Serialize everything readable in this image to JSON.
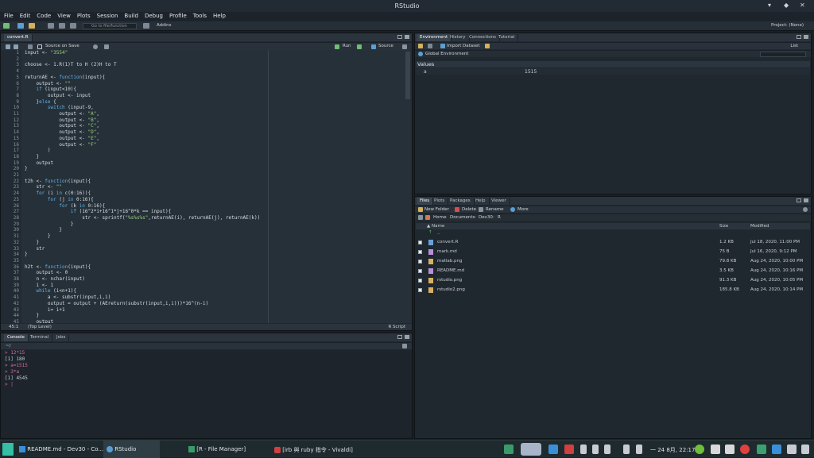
{
  "window": {
    "title": "RStudio"
  },
  "menu": [
    "File",
    "Edit",
    "Code",
    "View",
    "Plots",
    "Session",
    "Build",
    "Debug",
    "Profile",
    "Tools",
    "Help"
  ],
  "toolbar": {
    "goto_placeholder": "Go to file/function",
    "addins": "Addins",
    "project": "Project: (None)"
  },
  "editor": {
    "tab": "convert.R",
    "source_on_save": "Source on Save",
    "run": "Run",
    "source": "Source",
    "status_pos": "45:1",
    "status_scope": "(Top Level)",
    "status_type": "R Script",
    "lines": [
      "input <- \"3554\"",
      "",
      "choose <- 1.R(1)T to H (2)H to T",
      "",
      "returnAE <- function(input){",
      "    output <- \"\"",
      "    if (input<10){",
      "        output <- input",
      "    }else {",
      "        switch (input-9,",
      "            output <- \"A\",",
      "            output <- \"B\",",
      "            output <- \"C\",",
      "            output <- \"D\",",
      "            output <- \"E\",",
      "            output <- \"F\"",
      "        )",
      "    }",
      "    output",
      "}",
      "",
      "t2h <- function(input){",
      "    str <- \"\"",
      "    for (i in c(0:16)){",
      "        for (j in 0:16){",
      "            for (k in 0:16){",
      "                if (16^2*i+16^1*j+16^0*k == input){",
      "                    str <- sprintf(\"%s%s%s\",returnAE(i), returnAE(j), returnAE(k))",
      "                }",
      "            }",
      "        }",
      "    }",
      "    str",
      "}",
      "",
      "h2t <- function(input){",
      "    output <- 0",
      "    n <- nchar(input)",
      "    i <- 1",
      "    while (i<n+1){",
      "        a <- substr(input,i,i)",
      "        output = output + (AEreturn(substr(input,i,i)))*16^(n-i)",
      "        i= i+1",
      "    }",
      "    output"
    ]
  },
  "console": {
    "tabs": [
      "Console",
      "Terminal",
      "Jobs"
    ],
    "path": "~/",
    "lines": [
      {
        "t": "prompt",
        "v": "> 12*15"
      },
      {
        "t": "out",
        "v": "[1] 180"
      },
      {
        "t": "prompt",
        "v": "> a=1515"
      },
      {
        "t": "prompt",
        "v": "> 3*a"
      },
      {
        "t": "out",
        "v": "[1] 4545"
      },
      {
        "t": "prompt",
        "v": "> |"
      }
    ]
  },
  "env": {
    "tabs": [
      "Environment",
      "History",
      "Connections",
      "Tutorial"
    ],
    "import": "Import Dataset",
    "scope": "Global Environment",
    "list": "List",
    "section": "Values",
    "var_name": "a",
    "var_value": "1515"
  },
  "files": {
    "tabs": [
      "Files",
      "Plots",
      "Packages",
      "Help",
      "Viewer"
    ],
    "new_folder": "New Folder",
    "delete": "Delete",
    "rename": "Rename",
    "more": "More",
    "breadcrumb": [
      "Home",
      "Documents",
      "Dev30",
      "R"
    ],
    "col_name": "Name",
    "col_size": "Size",
    "col_modified": "Modified",
    "up": "..",
    "rows": [
      {
        "name": "convert.R",
        "size": "1.2 KB",
        "modified": "Jul 18, 2020, 11:00 PM",
        "color": "#6aa0d8"
      },
      {
        "name": "mark.md",
        "size": "75 B",
        "modified": "Jul 16, 2020, 9:12 PM",
        "color": "#b890d8"
      },
      {
        "name": "matlab.png",
        "size": "79.8 KB",
        "modified": "Aug 24, 2020, 10:00 PM",
        "color": "#d8b060"
      },
      {
        "name": "README.md",
        "size": "3.5 KB",
        "modified": "Aug 24, 2020, 10:16 PM",
        "color": "#b890d8"
      },
      {
        "name": "rstudio.png",
        "size": "91.3 KB",
        "modified": "Aug 24, 2020, 10:05 PM",
        "color": "#d8b060"
      },
      {
        "name": "rstudio2.png",
        "size": "185.8 KB",
        "modified": "Aug 24, 2020, 10:14 PM",
        "color": "#d8b060"
      }
    ]
  },
  "taskbar": {
    "tasks": [
      "README.md - Dev30 - Co...",
      "RStudio",
      "[R - File Manager]",
      "[irb 與 ruby 指令 - Vivaldi]"
    ],
    "clock": "一 24 8月, 22:17"
  },
  "colors": {
    "accent": "#5fb1e8",
    "prompt": "#d06fa0",
    "bg": "#20282f"
  }
}
